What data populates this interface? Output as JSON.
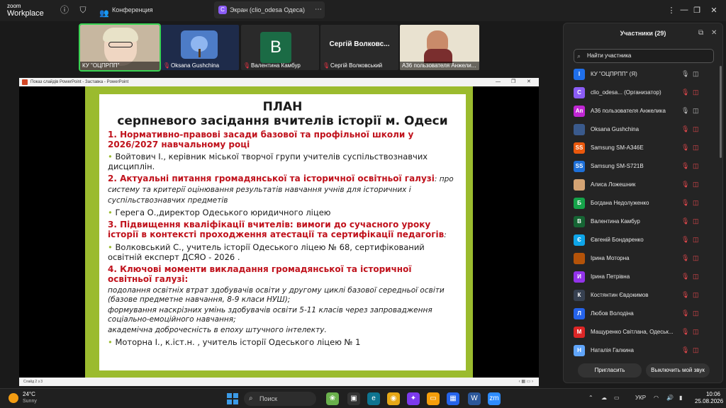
{
  "app": {
    "logo_line1": "zoom",
    "logo_line2": "Workplace"
  },
  "titlebar": {
    "tabs": [
      {
        "label": "Конференция"
      },
      {
        "label": "Экран (clio_odesa Одеса)",
        "badge": "C"
      }
    ]
  },
  "thumbnails": [
    {
      "name": "КУ \"ОЦПРПП\""
    },
    {
      "name": "Oksana Gushchina"
    },
    {
      "name": "Валентина Камбур",
      "letter": "В"
    },
    {
      "name": "Сергій Волковський",
      "title": "Сергій Волковс..."
    },
    {
      "name": "А36 пользователя Анжели..."
    }
  ],
  "powerpoint": {
    "title": "Показ слайдів PowerPoint - Заставка - PowerPoint",
    "status": "Слайд 2 з 3"
  },
  "slide": {
    "title": "ПЛАН",
    "subtitle": "серпневого засідання вчителів історії м. Одеси",
    "s1_heading": "1. Нормативно-правові засади базової та профільної школи у 2026/2027 навчальному році",
    "s1_bullet": "Войтович І., керівник міської творчої групи учителів суспільствознавчих дисциплін.",
    "s2_heading": "2. Актуальні питання громадянської та історичної освітньої галузі",
    "s2_detail": ": про систему та критерії оцінювання результатів навчання учнів для історичних і суспільствознавчих предметів",
    "s2_bullet": "Герега О.,директор Одеського юридичного ліцею",
    "s3_heading": "3. Підвищення кваліфікації вчителів: вимоги до сучасного уроку історії в контексті проходження атестації та сертифікації педагогів",
    "s3_suffix": ":",
    "s3_bullet": "Волковський С., учитель історії Одеського ліцею № 68, сертифікований освітній експерт ДСЯО - 2026 .",
    "s4_heading": "4. Ключові моменти викладання громадянської та історичної освітньої галузі:",
    "s4_p1": "подолання освітніх втрат здобувачів освіти у другому циклі базової середньої освіти (базове предметне навчання, 8-9 класи НУШ);",
    "s4_p2": "формування наскрізних умінь здобувачів освіти 5-11 класів через запровадження соціально-емоційного навчання;",
    "s4_p3": "академічна доброчесність в епоху штучного інтелекту.",
    "s4_bullet": "Моторна І., к.іст.н. , учитель історії Одеського ліцею № 1"
  },
  "participants": {
    "title": "Участники (29)",
    "search_placeholder": "Найти участника",
    "list": [
      {
        "initial": "І",
        "color": "#1f6feb",
        "name": "КУ \"ОЦПРПП\" (Я)",
        "mic": "on",
        "cam": "on"
      },
      {
        "initial": "C",
        "color": "#8b5cf6",
        "name": "clio_odesa... (Организатор)",
        "mic": "off",
        "cam": "off"
      },
      {
        "initial": "Ап",
        "color": "#c026d3",
        "name": "А36 пользователя Анжелика",
        "mic": "on",
        "cam": "on"
      },
      {
        "initial": "",
        "color": "#3a5a8c",
        "name": "Oksana Gushchina",
        "mic": "off",
        "cam": "off"
      },
      {
        "initial": "SS",
        "color": "#ea580c",
        "name": "Samsung SM-A346E",
        "mic": "off",
        "cam": "off"
      },
      {
        "initial": "SS",
        "color": "#1d6fd8",
        "name": "Samsung SM-S721B",
        "mic": "off",
        "cam": "off"
      },
      {
        "initial": "",
        "color": "#d4a373",
        "name": "Алиса Ложешник",
        "mic": "off",
        "cam": "off"
      },
      {
        "initial": "Б",
        "color": "#16a34a",
        "name": "Богдана Недолуженко",
        "mic": "off",
        "cam": "off"
      },
      {
        "initial": "В",
        "color": "#166534",
        "name": "Валентина Камбур",
        "mic": "off",
        "cam": "off"
      },
      {
        "initial": "Є",
        "color": "#0ea5e9",
        "name": "Євгеній Бондаренко",
        "mic": "off",
        "cam": "off"
      },
      {
        "initial": "",
        "color": "#b45309",
        "name": "Ірина Моторна",
        "mic": "off",
        "cam": "off"
      },
      {
        "initial": "И",
        "color": "#9333ea",
        "name": "Ірина Петрівна",
        "mic": "off",
        "cam": "off"
      },
      {
        "initial": "К",
        "color": "#374151",
        "name": "Костянтин Євдокимов",
        "mic": "off",
        "cam": "off"
      },
      {
        "initial": "Л",
        "color": "#2563eb",
        "name": "Любов Володіна",
        "mic": "off",
        "cam": "off"
      },
      {
        "initial": "М",
        "color": "#dc2626",
        "name": "Мащуренко Світлана, Одеськ...",
        "mic": "off",
        "cam": "off"
      },
      {
        "initial": "Н",
        "color": "#60a5fa",
        "name": "Наталія Галкина",
        "mic": "off",
        "cam": "off"
      }
    ],
    "invite_label": "Пригласить",
    "mute_all_label": "Выключить мой звук"
  },
  "taskbar": {
    "temp": "24°C",
    "condition": "Sunny",
    "search": "Поиск",
    "lang": "УКР",
    "time": "10:06",
    "date": "25.08.2026"
  }
}
